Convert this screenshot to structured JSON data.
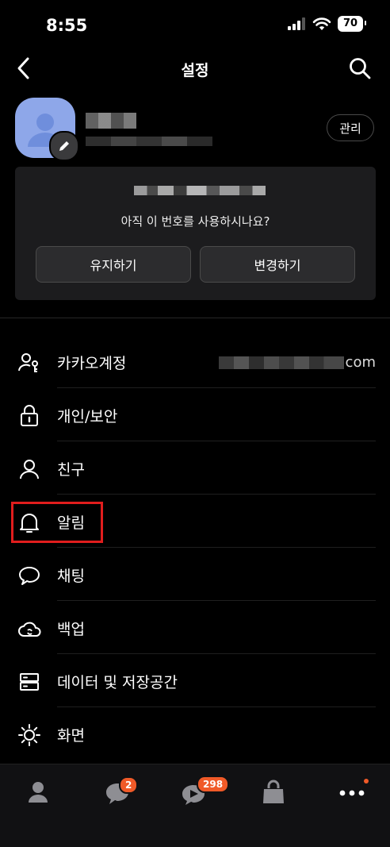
{
  "status_bar": {
    "time": "8:55",
    "battery": "70"
  },
  "nav": {
    "title": "설정"
  },
  "profile": {
    "manage_label": "관리"
  },
  "phone_card": {
    "question": "아직 이 번호를 사용하시나요?",
    "keep_label": "유지하기",
    "change_label": "변경하기"
  },
  "menu": {
    "items": [
      {
        "label": "카카오계정",
        "icon": "account-icon",
        "value_suffix": "com"
      },
      {
        "label": "개인/보안",
        "icon": "lock-icon"
      },
      {
        "label": "친구",
        "icon": "person-icon"
      },
      {
        "label": "알림",
        "icon": "bell-icon"
      },
      {
        "label": "채팅",
        "icon": "chat-bubble-icon"
      },
      {
        "label": "백업",
        "icon": "cloud-sync-icon"
      },
      {
        "label": "데이터 및 저장공간",
        "icon": "storage-icon"
      },
      {
        "label": "화면",
        "icon": "brightness-icon"
      }
    ]
  },
  "tab_bar": {
    "chats_badge": "2",
    "openchat_badge": "298"
  },
  "colors": {
    "accent_badge": "#f05a28",
    "highlight_box": "#e11d1d"
  }
}
